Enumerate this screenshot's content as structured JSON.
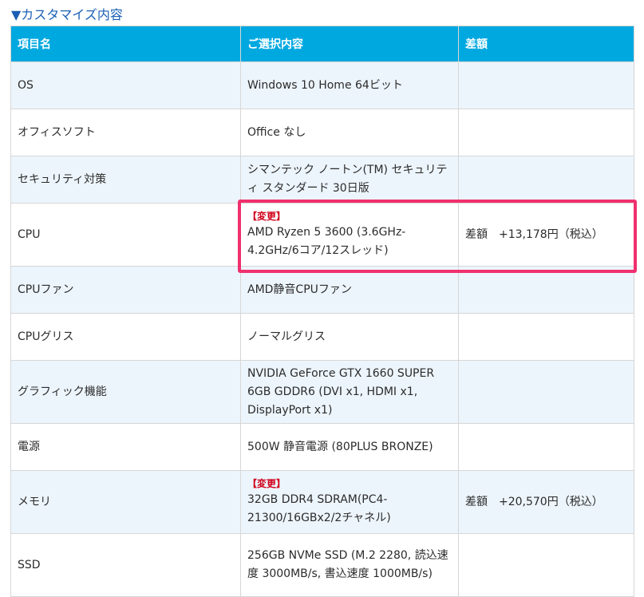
{
  "section_title": "▼カスタマイズ内容",
  "headers": {
    "item": "項目名",
    "selection": "ご選択内容",
    "difference": "差額"
  },
  "rows": [
    {
      "item": "OS",
      "selection": "Windows 10 Home 64ビット",
      "changed_label": "",
      "difference": ""
    },
    {
      "item": "オフィスソフト",
      "selection": "Office なし",
      "changed_label": "",
      "difference": ""
    },
    {
      "item": "セキュリティ対策",
      "selection": "シマンテック ノートン(TM) セキュリティ スタンダード 30日版",
      "changed_label": "",
      "difference": ""
    },
    {
      "item": "CPU",
      "selection": "AMD Ryzen 5 3600 (3.6GHz-4.2GHz/6コア/12スレッド)",
      "changed_label": "【変更】",
      "difference": "差額　+13,178円（税込）"
    },
    {
      "item": "CPUファン",
      "selection": "AMD静音CPUファン",
      "changed_label": "",
      "difference": ""
    },
    {
      "item": "CPUグリス",
      "selection": "ノーマルグリス",
      "changed_label": "",
      "difference": ""
    },
    {
      "item": "グラフィック機能",
      "selection": "NVIDIA GeForce GTX 1660 SUPER 6GB GDDR6 (DVI x1, HDMI x1, DisplayPort x1)",
      "changed_label": "",
      "difference": ""
    },
    {
      "item": "電源",
      "selection": "500W 静音電源 (80PLUS BRONZE)",
      "changed_label": "",
      "difference": ""
    },
    {
      "item": "メモリ",
      "selection": "32GB DDR4 SDRAM(PC4-21300/16GBx2/2チャネル)",
      "changed_label": "【変更】",
      "difference": "差額　+20,570円（税込）"
    },
    {
      "item": "SSD",
      "selection": "256GB NVMe SSD (M.2 2280, 読込速度 3000MB/s, 書込速度 1000MB/s)",
      "changed_label": "",
      "difference": ""
    }
  ],
  "colors": {
    "header_bg": "#00a8e0",
    "row_alt_bg": "#edf5fc",
    "changed_tag": "#d0021b",
    "highlight_border": "#f0306e",
    "title": "#1a5fb4"
  }
}
